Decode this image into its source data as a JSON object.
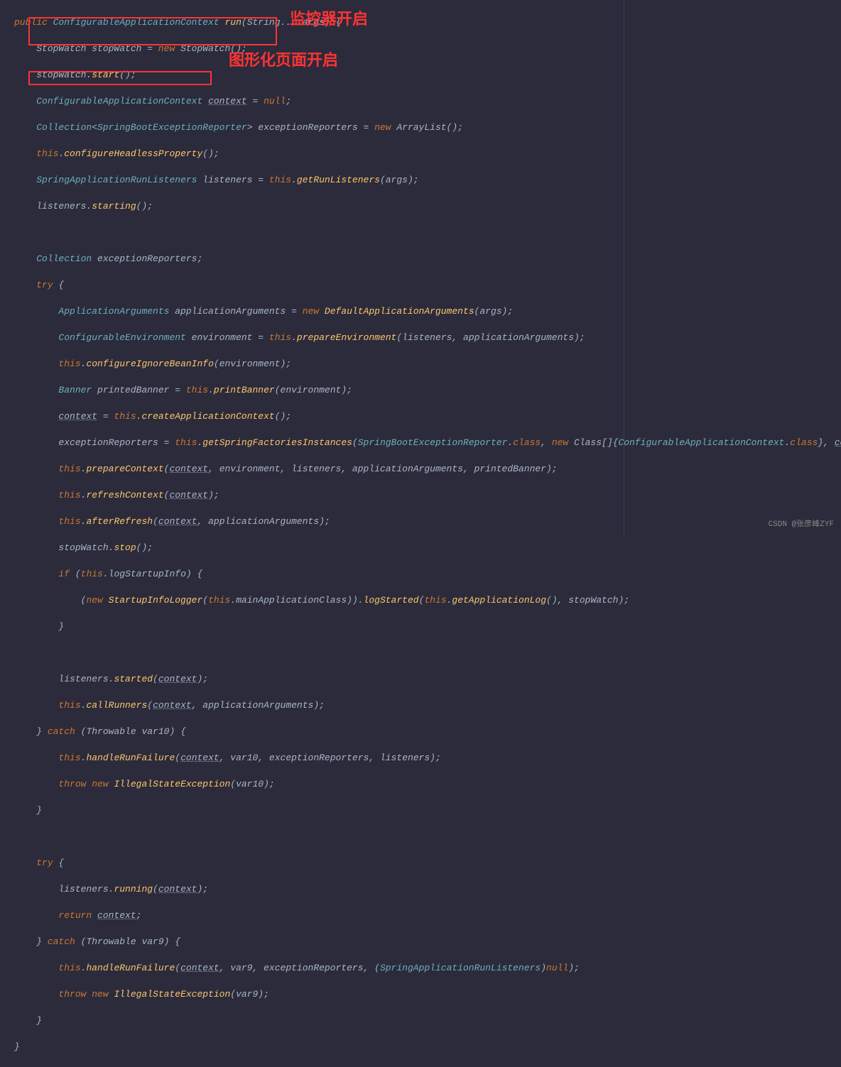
{
  "annotation1": "监控器开启",
  "annotation2": "图形化页面开启",
  "watermark": "CSDN @张彦峰ZYF",
  "code": {
    "l1a": "public",
    "l1b": "ConfigurableApplicationContext",
    "l1c": "run",
    "l1d": "(String... args) {",
    "l2a": "StopWatch stopWatch = ",
    "l2b": "new",
    "l2c": " StopWatch();",
    "l3a": "stopWatch.",
    "l3b": "start",
    "l3c": "();",
    "l4a": "ConfigurableApplicationContext",
    "l4b": " ",
    "l4c": "context",
    "l4d": " = ",
    "l4e": "null",
    "l4f": ";",
    "l5a": "Collection",
    "l5b": "<",
    "l5c": "SpringBootExceptionReporter",
    "l5d": "> exceptionReporters = ",
    "l5e": "new",
    "l5f": " ArrayList();",
    "l6a": "this",
    "l6b": ".",
    "l6c": "configureHeadlessProperty",
    "l6d": "();",
    "l7a": "SpringApplicationRunListeners",
    "l7b": " listeners = ",
    "l7c": "this",
    "l7d": ".",
    "l7e": "getRunListeners",
    "l7f": "(args);",
    "l8a": "listeners.",
    "l8b": "starting",
    "l8c": "();",
    "l9a": "Collection",
    "l9b": " exceptionReporters;",
    "l10a": "try",
    "l10b": " {",
    "l11a": "ApplicationArguments",
    "l11b": " applicationArguments = ",
    "l11c": "new",
    "l11d": " ",
    "l11e": "DefaultApplicationArguments",
    "l11f": "(args);",
    "l12a": "ConfigurableEnvironment",
    "l12b": " environment = ",
    "l12c": "this",
    "l12d": ".",
    "l12e": "prepareEnvironment",
    "l12f": "(listeners, applicationArguments);",
    "l13a": "this",
    "l13b": ".",
    "l13c": "configureIgnoreBeanInfo",
    "l13d": "(environment);",
    "l14a": "Banner",
    "l14b": " printedBanner = ",
    "l14c": "this",
    "l14d": ".",
    "l14e": "printBanner",
    "l14f": "(environment);",
    "l15a": "context",
    "l15b": " = ",
    "l15c": "this",
    "l15d": ".",
    "l15e": "createApplicationContext",
    "l15f": "();",
    "l16a": "exceptionReporters = ",
    "l16b": "this",
    "l16c": ".",
    "l16d": "getSpringFactoriesInstances",
    "l16e": "(",
    "l16f": "SpringBootExceptionReporter",
    "l16g": ".",
    "l16h": "class",
    "l16i": ", ",
    "l16j": "new",
    "l16k": " Class[]{",
    "l16l": "ConfigurableApplicationContext",
    "l16m": ".",
    "l16n": "class",
    "l16o": "}, ",
    "l16p": "context",
    "l16q": ");",
    "l17a": "this",
    "l17b": ".",
    "l17c": "prepareContext",
    "l17d": "(",
    "l17e": "context",
    "l17f": ", environment, listeners, applicationArguments, printedBanner);",
    "l18a": "this",
    "l18b": ".",
    "l18c": "refreshContext",
    "l18d": "(",
    "l18e": "context",
    "l18f": ");",
    "l19a": "this",
    "l19b": ".",
    "l19c": "afterRefresh",
    "l19d": "(",
    "l19e": "context",
    "l19f": ", applicationArguments);",
    "l20a": "stopWatch.",
    "l20b": "stop",
    "l20c": "();",
    "l21a": "if",
    "l21b": " (",
    "l21c": "this",
    "l21d": ".logStartupInfo) {",
    "l22a": "(",
    "l22b": "new",
    "l22c": " ",
    "l22d": "StartupInfoLogger",
    "l22e": "(",
    "l22f": "this",
    "l22g": ".mainApplicationClass)).",
    "l22h": "logStarted",
    "l22i": "(",
    "l22j": "this",
    "l22k": ".",
    "l22l": "getApplicationLog",
    "l22m": "(), stopWatch);",
    "l23a": "}",
    "l24a": "listeners.",
    "l24b": "started",
    "l24c": "(",
    "l24d": "context",
    "l24e": ");",
    "l25a": "this",
    "l25b": ".",
    "l25c": "callRunners",
    "l25d": "(",
    "l25e": "context",
    "l25f": ", applicationArguments);",
    "l26a": "} ",
    "l26b": "catch",
    "l26c": " (Throwable var10) {",
    "l27a": "this",
    "l27b": ".",
    "l27c": "handleRunFailure",
    "l27d": "(",
    "l27e": "context",
    "l27f": ", var10, exceptionReporters, listeners);",
    "l28a": "throw new",
    "l28b": " ",
    "l28c": "IllegalStateException",
    "l28d": "(var10);",
    "l29a": "}",
    "l30a": "try",
    "l30b": " {",
    "l31a": "listeners.",
    "l31b": "running",
    "l31c": "(",
    "l31d": "context",
    "l31e": ");",
    "l32a": "return",
    "l32b": " ",
    "l32c": "context",
    "l32d": ";",
    "l33a": "} ",
    "l33b": "catch",
    "l33c": " (Throwable var9) {",
    "l34a": "this",
    "l34b": ".",
    "l34c": "handleRunFailure",
    "l34d": "(",
    "l34e": "context",
    "l34f": ", var9, exceptionReporters, (",
    "l34g": "SpringApplicationRunListeners",
    "l34h": ")",
    "l34i": "null",
    "l34j": ");",
    "l35a": "throw new",
    "l35b": " ",
    "l35c": "IllegalStateException",
    "l35d": "(var9);",
    "l36a": "}",
    "l37a": "}"
  }
}
